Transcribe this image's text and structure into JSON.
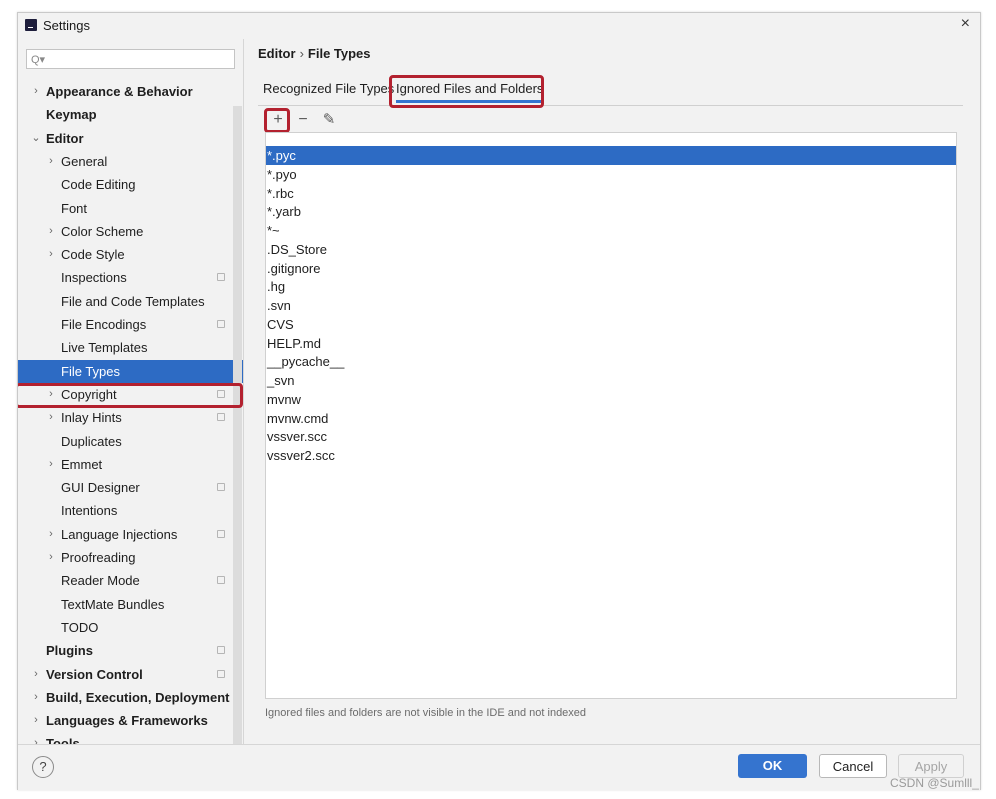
{
  "window": {
    "title": "Settings",
    "close": "×"
  },
  "search": {
    "placeholder": ""
  },
  "sidebar": {
    "items": [
      {
        "label": "Appearance & Behavior",
        "bold": true,
        "arrow": "›",
        "level": 0
      },
      {
        "label": "Keymap",
        "bold": true,
        "arrow": "",
        "level": 0
      },
      {
        "label": "Editor",
        "bold": true,
        "arrow": "⌄",
        "level": 0
      },
      {
        "label": "General",
        "arrow": "›",
        "level": 1
      },
      {
        "label": "Code Editing",
        "arrow": "",
        "level": 1
      },
      {
        "label": "Font",
        "arrow": "",
        "level": 1
      },
      {
        "label": "Color Scheme",
        "arrow": "›",
        "level": 1
      },
      {
        "label": "Code Style",
        "arrow": "›",
        "level": 1
      },
      {
        "label": "Inspections",
        "arrow": "",
        "level": 1,
        "proj": true
      },
      {
        "label": "File and Code Templates",
        "arrow": "",
        "level": 1
      },
      {
        "label": "File Encodings",
        "arrow": "",
        "level": 1,
        "proj": true
      },
      {
        "label": "Live Templates",
        "arrow": "",
        "level": 1
      },
      {
        "label": "File Types",
        "arrow": "",
        "level": 1,
        "selected": true
      },
      {
        "label": "Copyright",
        "arrow": "›",
        "level": 1,
        "proj": true
      },
      {
        "label": "Inlay Hints",
        "arrow": "›",
        "level": 1,
        "proj": true
      },
      {
        "label": "Duplicates",
        "arrow": "",
        "level": 1
      },
      {
        "label": "Emmet",
        "arrow": "›",
        "level": 1
      },
      {
        "label": "GUI Designer",
        "arrow": "",
        "level": 1,
        "proj": true
      },
      {
        "label": "Intentions",
        "arrow": "",
        "level": 1
      },
      {
        "label": "Language Injections",
        "arrow": "›",
        "level": 1,
        "proj": true
      },
      {
        "label": "Proofreading",
        "arrow": "›",
        "level": 1
      },
      {
        "label": "Reader Mode",
        "arrow": "",
        "level": 1,
        "proj": true
      },
      {
        "label": "TextMate Bundles",
        "arrow": "",
        "level": 1
      },
      {
        "label": "TODO",
        "arrow": "",
        "level": 1
      },
      {
        "label": "Plugins",
        "bold": true,
        "arrow": "",
        "level": 0,
        "proj": true
      },
      {
        "label": "Version Control",
        "bold": true,
        "arrow": "›",
        "level": 0,
        "proj": true
      },
      {
        "label": "Build, Execution, Deployment",
        "bold": true,
        "arrow": "›",
        "level": 0
      },
      {
        "label": "Languages & Frameworks",
        "bold": true,
        "arrow": "›",
        "level": 0
      },
      {
        "label": "Tools",
        "bold": true,
        "arrow": "›",
        "level": 0
      }
    ]
  },
  "breadcrumb": {
    "parent": "Editor",
    "separator": "›",
    "current": "File Types"
  },
  "tabs": {
    "recognized": "Recognized File Types",
    "ignored": "Ignored Files and Folders"
  },
  "toolbar": {
    "add": "+",
    "remove": "−",
    "edit": "✎"
  },
  "ignored_list": [
    "*.pyc",
    "*.pyo",
    "*.rbc",
    "*.yarb",
    "*~",
    ".DS_Store",
    ".gitignore",
    ".hg",
    ".svn",
    "CVS",
    "HELP.md",
    "__pycache__",
    "_svn",
    "mvnw",
    "mvnw.cmd",
    "vssver.scc",
    "vssver2.scc"
  ],
  "selected_index": 0,
  "footnote": "Ignored files and folders are not visible in the IDE and not indexed",
  "buttons": {
    "help": "?",
    "ok": "OK",
    "cancel": "Cancel",
    "apply": "Apply"
  },
  "watermark": "CSDN @Sumlll_",
  "colors": {
    "accent": "#3574cf",
    "selection": "#2d6bc4",
    "highlight_box": "#b3212f"
  }
}
